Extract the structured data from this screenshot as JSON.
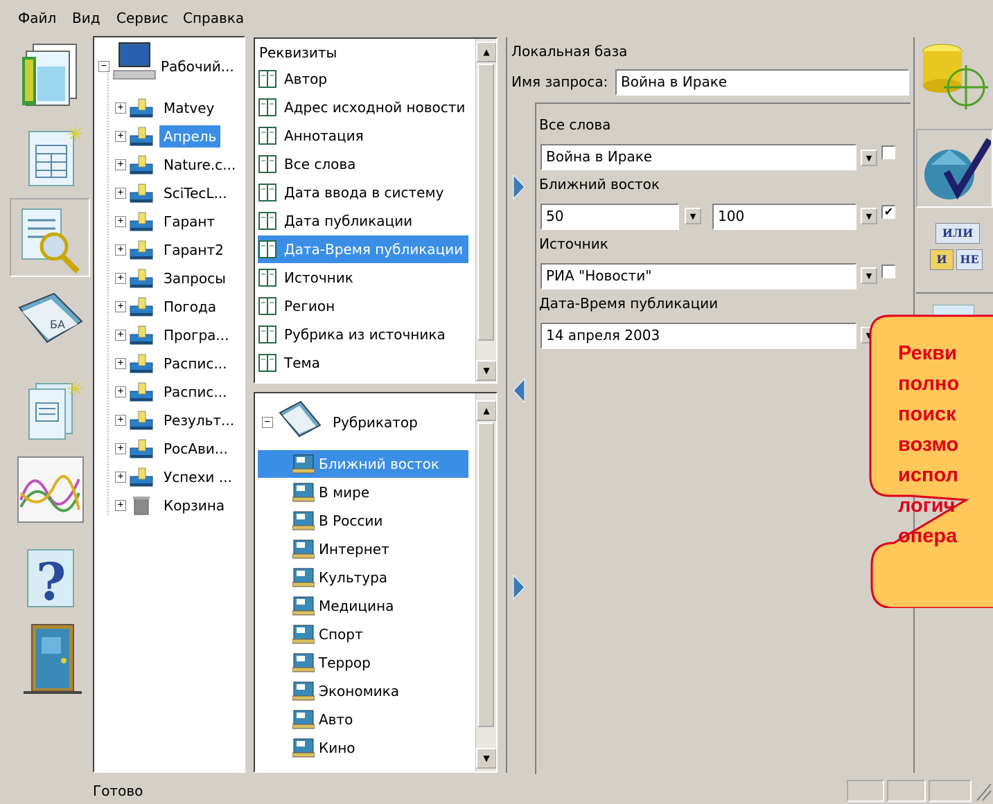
{
  "menu": [
    "Файл",
    "Вид",
    "Сервис",
    "Справка"
  ],
  "tree": {
    "root": "Рабочий...",
    "items": [
      "Matvey",
      "Апрель",
      "Nature.c...",
      "SciTecL...",
      "Гарант",
      "Гарант2",
      "Запросы",
      "Погода",
      "Програ...",
      "Распис...",
      "Распис...",
      "Результ...",
      "РосАви...",
      "Успехи ...",
      "Корзина"
    ]
  },
  "attributes": {
    "header": "Реквизиты",
    "items": [
      "Автор",
      "Адрес исходной новости",
      "Аннотация",
      "Все слова",
      "Дата ввода в систему",
      "Дата публикации",
      "Дата-Время публикации",
      "Источник",
      "Регион",
      "Рубрика из источника",
      "Тема"
    ]
  },
  "rubricator": {
    "root": "Рубрикатор",
    "items": [
      "Ближний восток",
      "В мире",
      "В России",
      "Интернет",
      "Культура",
      "Медицина",
      "Спорт",
      "Террор",
      "Экономика",
      "Авто",
      "Кино"
    ]
  },
  "query": {
    "db_label": "Локальная база",
    "name_label": "Имя запроса:",
    "name_value": "Война в Ираке",
    "fields": [
      {
        "label": "Все слова",
        "value": "Война в Ираке",
        "checked": ""
      },
      {
        "label": "Ближний восток",
        "value": "50",
        "value2": "100",
        "checked": "✔"
      },
      {
        "label": "Источник",
        "value": "РИА \"Новости\"",
        "checked": ""
      },
      {
        "label": "Дата-Время публикации",
        "value": "14 апреля 2003",
        "checked": ""
      }
    ]
  },
  "logic": {
    "or": "ИЛИ",
    "and": "И",
    "not": "НЕ"
  },
  "callout": {
    "lines": [
      "Рекви",
      "полно",
      "поиск",
      "возмо",
      "испол",
      "логич",
      "опера"
    ]
  },
  "status": {
    "text": "Готово"
  },
  "colors": {
    "selection": "#3a8ee6",
    "callout_fill": "#ffc85a",
    "callout_text": "#e0001a",
    "background": "#1a1a7a"
  }
}
